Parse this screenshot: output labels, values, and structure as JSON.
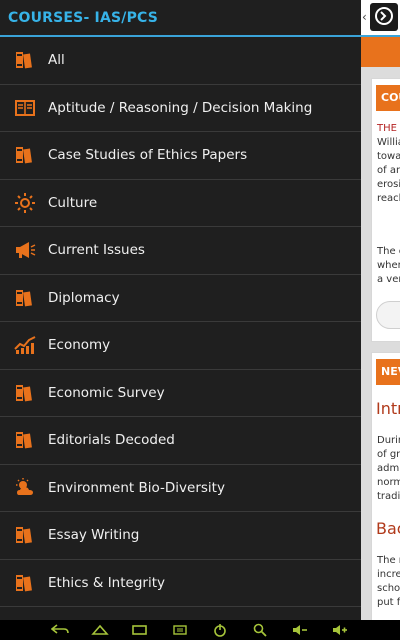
{
  "drawer": {
    "title": "COURSES- IAS/PCS",
    "items": [
      {
        "label": "All",
        "icon": "books-icon"
      },
      {
        "label": "Aptitude / Reasoning / Decision Making",
        "icon": "book-list-icon"
      },
      {
        "label": "Case Studies of Ethics Papers",
        "icon": "books-icon"
      },
      {
        "label": "Culture",
        "icon": "sun-icon"
      },
      {
        "label": "Current Issues",
        "icon": "megaphone-icon"
      },
      {
        "label": "Diplomacy",
        "icon": "books-icon"
      },
      {
        "label": "Economy",
        "icon": "chart-icon"
      },
      {
        "label": "Economic Survey",
        "icon": "books-icon"
      },
      {
        "label": "Editorials Decoded",
        "icon": "books-icon"
      },
      {
        "label": "Environment Bio-Diversity",
        "icon": "weather-icon"
      },
      {
        "label": "Essay Writing",
        "icon": "books-icon"
      },
      {
        "label": "Ethics & Integrity",
        "icon": "books-icon"
      }
    ]
  },
  "content": {
    "card1_header": "COU",
    "card1_lines": [
      "THE C",
      "Willia",
      "towa",
      "of an",
      "erosi",
      "reach"
    ],
    "card1_lines2": [
      "The c",
      "wher",
      "a ver"
    ],
    "card2_header": "NEV",
    "card2_title1": "Intr",
    "card2_lines": [
      "Durin",
      "of gri",
      "admi",
      "norm",
      "tradit"
    ],
    "card2_title2": "Bac",
    "card2_lines2": [
      "The n",
      "incre",
      "schol",
      "put fo"
    ]
  },
  "colors": {
    "accent": "#37b3e8",
    "orange": "#e8721c"
  }
}
